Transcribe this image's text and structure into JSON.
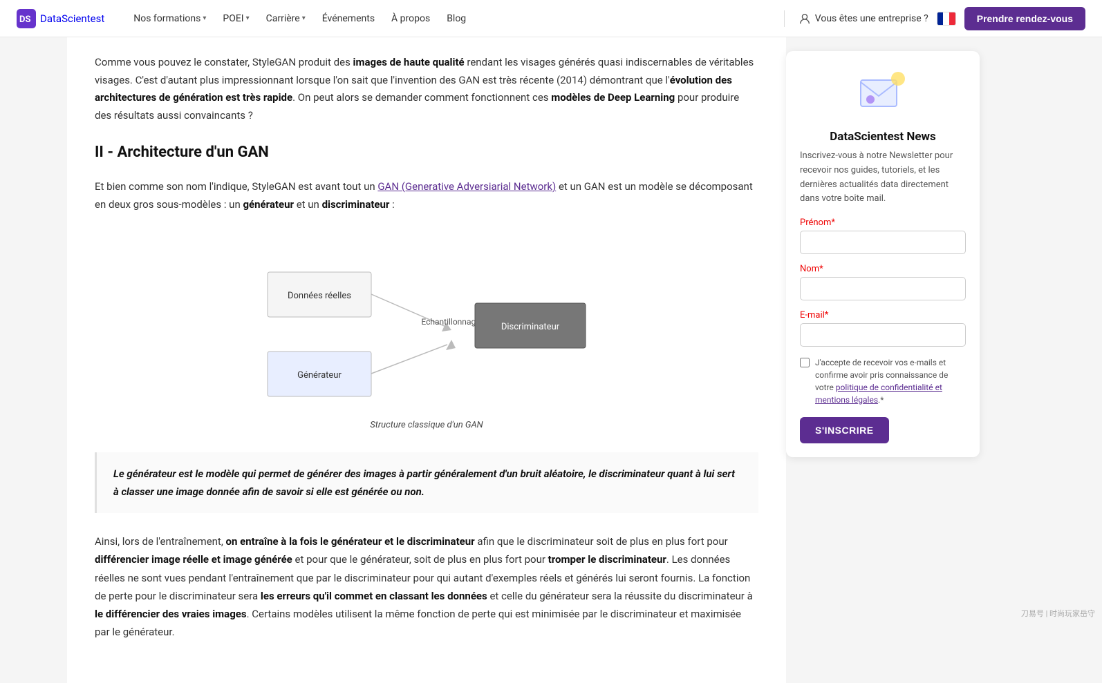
{
  "nav": {
    "logo_text": "DataScientest",
    "formations_label": "Nos formations",
    "poei_label": "POEI",
    "carriere_label": "Carrière",
    "evenements_label": "Événements",
    "a_propos_label": "À propos",
    "blog_label": "Blog",
    "enterprise_label": "Vous êtes une entreprise ?",
    "cta_label": "Prendre rendez-vous"
  },
  "article": {
    "intro_p1_plain": "Comme vous pouvez le constater, StyleGAN produit des ",
    "intro_bold1": "images de haute qualité",
    "intro_p1_after": " rendant les visages générés quasi indiscernables de véritables visages. C'est d'autant plus impressionnant lorsque l'on sait que l'invention des GAN est très récente (2014) démontrant que l'",
    "intro_bold2": "évolution des architectures de génération est très rapide",
    "intro_p1_end": ". On peut alors se demander comment fonctionnent ces ",
    "intro_bold3": "modèles de Deep Learning",
    "intro_p1_final": " pour produire des résultats aussi convaincants ?",
    "section2_title": "II - Architecture d'un GAN",
    "para2_start": "Et bien comme son nom l'indique, StyleGAN est avant tout un ",
    "para2_link": "GAN (Generative Adversiarial Network)",
    "para2_after": " et un GAN est un modèle se décomposant en deux gros sous-modèles : un ",
    "para2_bold1": "générateur",
    "para2_between": " et un ",
    "para2_bold2": "discriminateur",
    "para2_end": " :",
    "diagram_caption": "Structure classique d'un GAN",
    "blockquote": "Le générateur est le modèle qui permet de générer des images à partir généralement d'un bruit aléatoire, le discriminateur quant à lui sert à classer une image donnée afin de savoir si elle est générée ou non.",
    "para3_start": "Ainsi, lors de l'entraînement, ",
    "para3_bold1": "on entraîne à la fois le générateur et le discriminateur",
    "para3_after1": " afin que le discriminateur soit de plus en plus fort pour ",
    "para3_bold2": "différencier image réelle et image générée",
    "para3_after2": " et pour que le générateur, soit de plus en plus fort pour ",
    "para3_bold3": "tromper le discriminateur",
    "para3_after3": ". Les données réelles ne sont vues pendant l'entraînement que par le discriminateur pour qui autant d'exemples réels et générés lui seront fournis. La fonction de perte pour le discriminateur sera ",
    "para3_bold4": "les erreurs qu'il commet en classant les données",
    "para3_after4": " et celle du générateur sera la réussite du discriminateur à ",
    "para3_bold5": "le différencier des vraies images",
    "para3_end": ". Certains modèles utilisent la même fonction de perte qui est minimisée par le discriminateur et maximisée par le générateur."
  },
  "diagram": {
    "donnees_label": "Données réelles",
    "echantillonnage_label": "Echantillonnage",
    "discriminateur_label": "Discriminateur",
    "generateur_label": "Générateur"
  },
  "newsletter": {
    "title": "DataScientest News",
    "desc": "Inscrivez-vous à notre Newsletter pour recevoir nos guides, tutoriels, et les dernières actualités data directement dans votre boîte mail.",
    "prenom_label": "Prénom",
    "nom_label": "Nom",
    "email_label": "E-mail",
    "checkbox_text": "J'accepte de recevoir vos e-mails et confirme avoir pris connaissance de votre politique de confidentialité et mentions légales.",
    "subscribe_label": "S'INSCRIRE"
  },
  "watermark": "刀易号 | 时尚玩家岳守"
}
